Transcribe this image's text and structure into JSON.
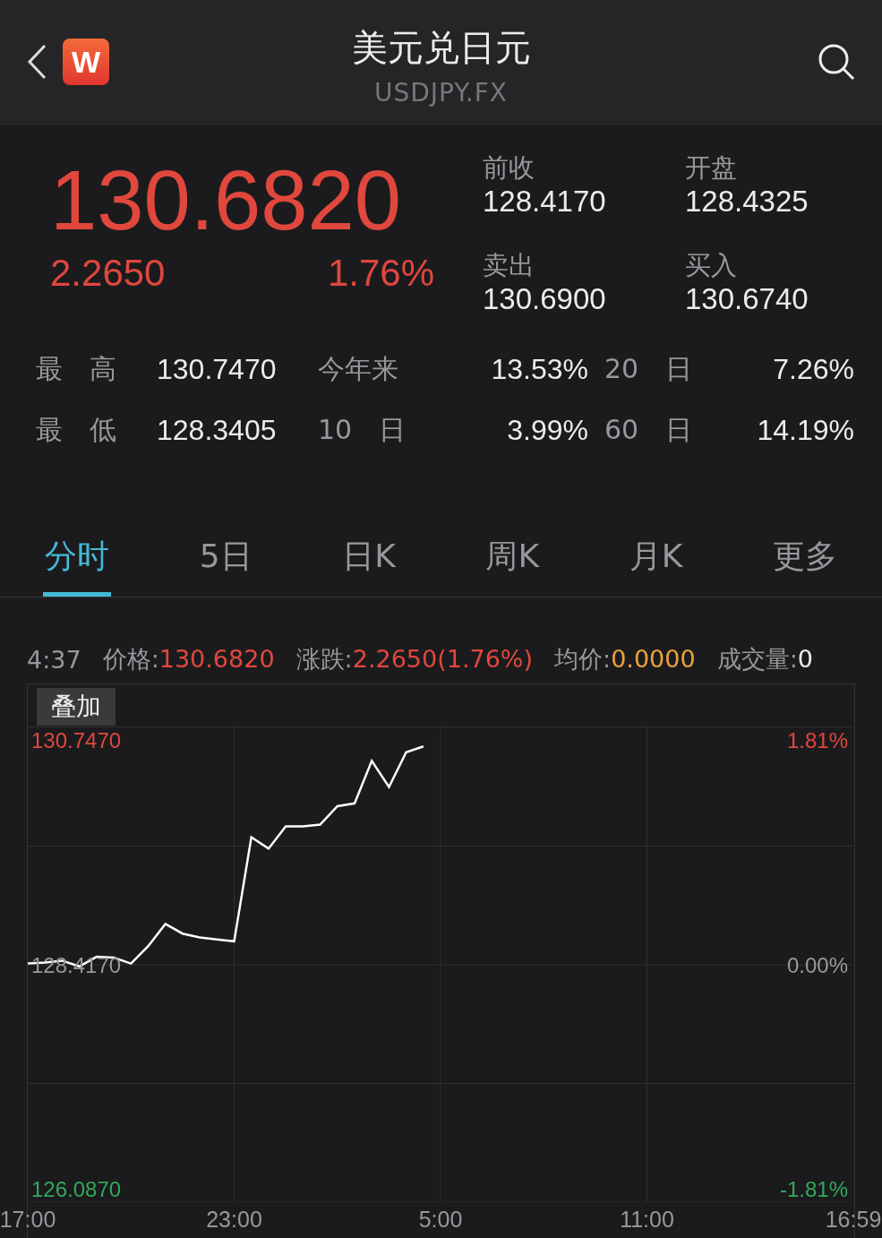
{
  "header": {
    "title": "美元兑日元",
    "subtitle": "USDJPY.FX",
    "logo": "W"
  },
  "quote": {
    "price": "130.6820",
    "change": "2.2650",
    "change_pct": "1.76%",
    "fields": [
      {
        "label": "前收",
        "value": "128.4170"
      },
      {
        "label": "开盘",
        "value": "128.4325"
      },
      {
        "label": "卖出",
        "value": "130.6900"
      },
      {
        "label": "买入",
        "value": "130.6740"
      }
    ]
  },
  "stats": [
    {
      "label": "最 高",
      "value": "130.7470"
    },
    {
      "label": "今年来",
      "value": "13.53%"
    },
    {
      "label": "20 日",
      "value": "7.26%"
    },
    {
      "label": "最 低",
      "value": "128.3405"
    },
    {
      "label": "10 日",
      "value": "3.99%"
    },
    {
      "label": "60 日",
      "value": "14.19%"
    }
  ],
  "tabs": [
    {
      "label": "分时",
      "selected": true
    },
    {
      "label": "5日",
      "selected": false
    },
    {
      "label": "日K",
      "selected": false
    },
    {
      "label": "周K",
      "selected": false
    },
    {
      "label": "月K",
      "selected": false
    },
    {
      "label": "更多",
      "selected": false
    }
  ],
  "info": {
    "time": "4:37",
    "items": [
      {
        "label": "价格:",
        "value": "130.6820",
        "color": "#e0473d"
      },
      {
        "label": "涨跌:",
        "value": "2.2650(1.76%)",
        "color": "#e0473d"
      },
      {
        "label": "均价:",
        "value": "0.0000",
        "color": "#e9a23b"
      },
      {
        "label": "成交量:",
        "value": "0",
        "color": "#ececec"
      }
    ]
  },
  "chart": {
    "overlay_button": "叠加",
    "right_labels": [
      {
        "label": "1.81%",
        "color": "#e0473d"
      },
      {
        "label": "0.00%",
        "color": "#98989c"
      },
      {
        "label": "-1.81%",
        "color": "#33a85c"
      }
    ],
    "chart_data": {
      "type": "line",
      "grid": true,
      "categories": [
        "17:00",
        null,
        null,
        null,
        null,
        null,
        null,
        null,
        null,
        null,
        null,
        null,
        "23:00",
        null,
        null,
        null,
        null,
        null,
        null,
        null,
        null,
        null,
        null,
        null,
        "5:00",
        null,
        null,
        null,
        null,
        null,
        null,
        null,
        null,
        null,
        null,
        null,
        "11:00",
        null,
        null,
        null,
        null,
        null,
        null,
        null,
        null,
        null,
        null,
        null,
        "16:59"
      ],
      "series": [
        {
          "color": "#ffffff",
          "values": [
            128.43,
            128.44,
            128.46,
            128.4,
            128.5,
            128.49,
            128.43,
            128.61,
            128.84,
            128.74,
            128.7,
            128.68,
            128.66,
            129.74,
            129.62,
            129.85,
            129.85,
            129.87,
            130.06,
            130.09,
            130.53,
            130.26,
            130.62,
            130.68,
            null,
            null,
            null,
            null,
            null,
            null,
            null,
            null,
            null,
            null,
            null,
            null,
            null,
            null,
            null,
            null,
            null,
            null,
            null,
            null,
            null,
            null,
            null,
            null,
            null
          ]
        }
      ],
      "ylim": [
        125.957,
        130.877
      ],
      "yticks": [
        {
          "value": 130.747,
          "label": "130.7470"
        },
        {
          "value": 128.417,
          "label": "128.4170"
        },
        {
          "value": 126.087,
          "label": "126.0870"
        }
      ]
    }
  }
}
